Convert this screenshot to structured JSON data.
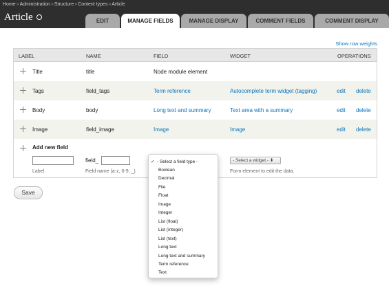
{
  "breadcrumb": [
    "Home",
    "Administration",
    "Structure",
    "Content types",
    "Article"
  ],
  "breadcrumb_separator": "»",
  "page_title": "Article",
  "tabs": [
    {
      "label": "EDIT"
    },
    {
      "label": "MANAGE FIELDS"
    },
    {
      "label": "MANAGE DISPLAY"
    },
    {
      "label": "COMMENT FIELDS"
    },
    {
      "label": "COMMENT DISPLAY"
    }
  ],
  "active_tab": "MANAGE FIELDS",
  "show_row_weights": "Show row weights",
  "table": {
    "headers": [
      "LABEL",
      "NAME",
      "FIELD",
      "WIDGET",
      "OPERATIONS"
    ],
    "rows": [
      {
        "label": "Title",
        "name": "title",
        "field": "Node module element",
        "widget": "",
        "edit": "",
        "delete": ""
      },
      {
        "label": "Tags",
        "name": "field_tags",
        "field": "Term reference",
        "widget": "Autocomplete term widget (tagging)",
        "edit": "edit",
        "delete": "delete"
      },
      {
        "label": "Body",
        "name": "body",
        "field": "Long text and summary",
        "widget": "Text area with a summary",
        "edit": "edit",
        "delete": "delete"
      },
      {
        "label": "Image",
        "name": "field_image",
        "field": "Image",
        "widget": "Image",
        "edit": "edit",
        "delete": "delete"
      }
    ]
  },
  "add_new_field": {
    "title": "Add new field",
    "label_value": "",
    "label_hint": "Label",
    "name_prefix": "field_",
    "name_value": "",
    "name_hint": "Field name (a-z, 0-9, _)",
    "widget_select": "- Select a widget -",
    "widget_hint": "Form element to edit the data."
  },
  "field_type_dropdown": {
    "selected": "- Select a field type -",
    "options": [
      "Boolean",
      "Decimal",
      "File",
      "Float",
      "Image",
      "Integer",
      "List (float)",
      "List (integer)",
      "List (text)",
      "Long text",
      "Long text and summary",
      "Term reference",
      "Text"
    ]
  },
  "save_label": "Save",
  "colors": {
    "header_bg": "#2e2e2e",
    "link": "#0b74b8",
    "row_alt": "#f2f3ec",
    "tab_inactive": "#a9a9a9"
  }
}
